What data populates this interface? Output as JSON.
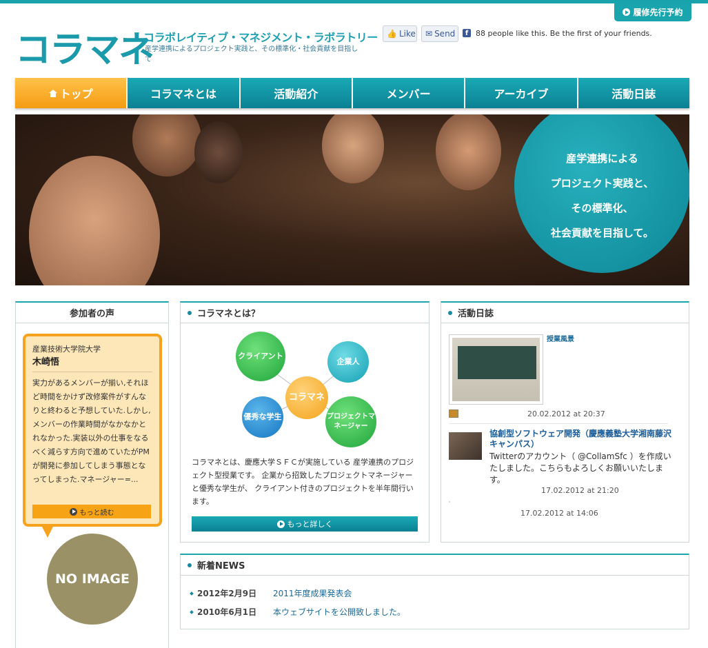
{
  "header": {
    "reserve_button": "履修先行予約",
    "logo": "コラマネ",
    "logo_subtitle": "コラボレイティブ・マネジメント・ラボラトリー",
    "logo_tagline": "産学連携によるプロジェクト実践と、その標準化・社会貢献を目指して",
    "fb_like": "Like",
    "fb_send": "Send",
    "fb_text": "88 people like this. Be the first of your friends."
  },
  "nav": {
    "items": [
      "トップ",
      "コラマネとは",
      "活動紹介",
      "メンバー",
      "アーカイブ",
      "活動日誌"
    ]
  },
  "hero": {
    "lines": [
      "産学連携による",
      "プロジェクト実践と、",
      "その標準化、",
      "社会貢献を目指して。"
    ]
  },
  "voice": {
    "title": "参加者の声",
    "org": "産業技術大学院大学",
    "name": "木崎悟",
    "text": "実力があるメンバーが揃い,それほど時間をかけず改修案件がすんなりと終わると予想していた.しかし,メンバーの作業時間がなかなかとれなかった.実装以外の仕事をなるべく減らす方向で進めていたがPMが開発に参加してしまう事態となってしまった.マネージャー=...",
    "more": "もっと読む",
    "no_image": "NO IMAGE"
  },
  "about": {
    "title": "コラマネとは？",
    "nodes": {
      "client": "クライアント",
      "company": "企業人",
      "center": "コラマネ",
      "student": "優秀な学生",
      "pm": "プロジェクトマネージャー"
    },
    "text": "コラマネとは、慶應大学ＳＦＣが実施している 産学連携のプロジェクト型授業です。 企業から招致したプロジェクトマネージャーと優秀な学生が、 クライアント付きのプロジェクトを半年間行います。",
    "detail": "もっと詳しく"
  },
  "diary": {
    "title": "活動日誌",
    "entry1_title": "授業風景",
    "entry1_date": "20.02.2012 at 20:37",
    "entry2_title": "協創型ソフトウェア開発（慶應義塾大学湘南藤沢キャンパス）",
    "entry2_body": "Twitterのアカウント（ @CollamSfc ）を作成いたしました。こちらもよろしくお願いいたします。",
    "entry2_date": "17.02.2012 at 21:20",
    "entry3_date": "17.02.2012 at 14:06"
  },
  "news": {
    "title": "新着NEWS",
    "items": [
      {
        "date": "2012年2月9日",
        "text": "2011年度成果発表会"
      },
      {
        "date": "2010年6月1日",
        "text": "本ウェブサイトを公開致しました。"
      }
    ]
  },
  "colors": {
    "accent": "#1aa4ae",
    "active_nav": "#f59b13",
    "bubble": "#fde7b8"
  }
}
